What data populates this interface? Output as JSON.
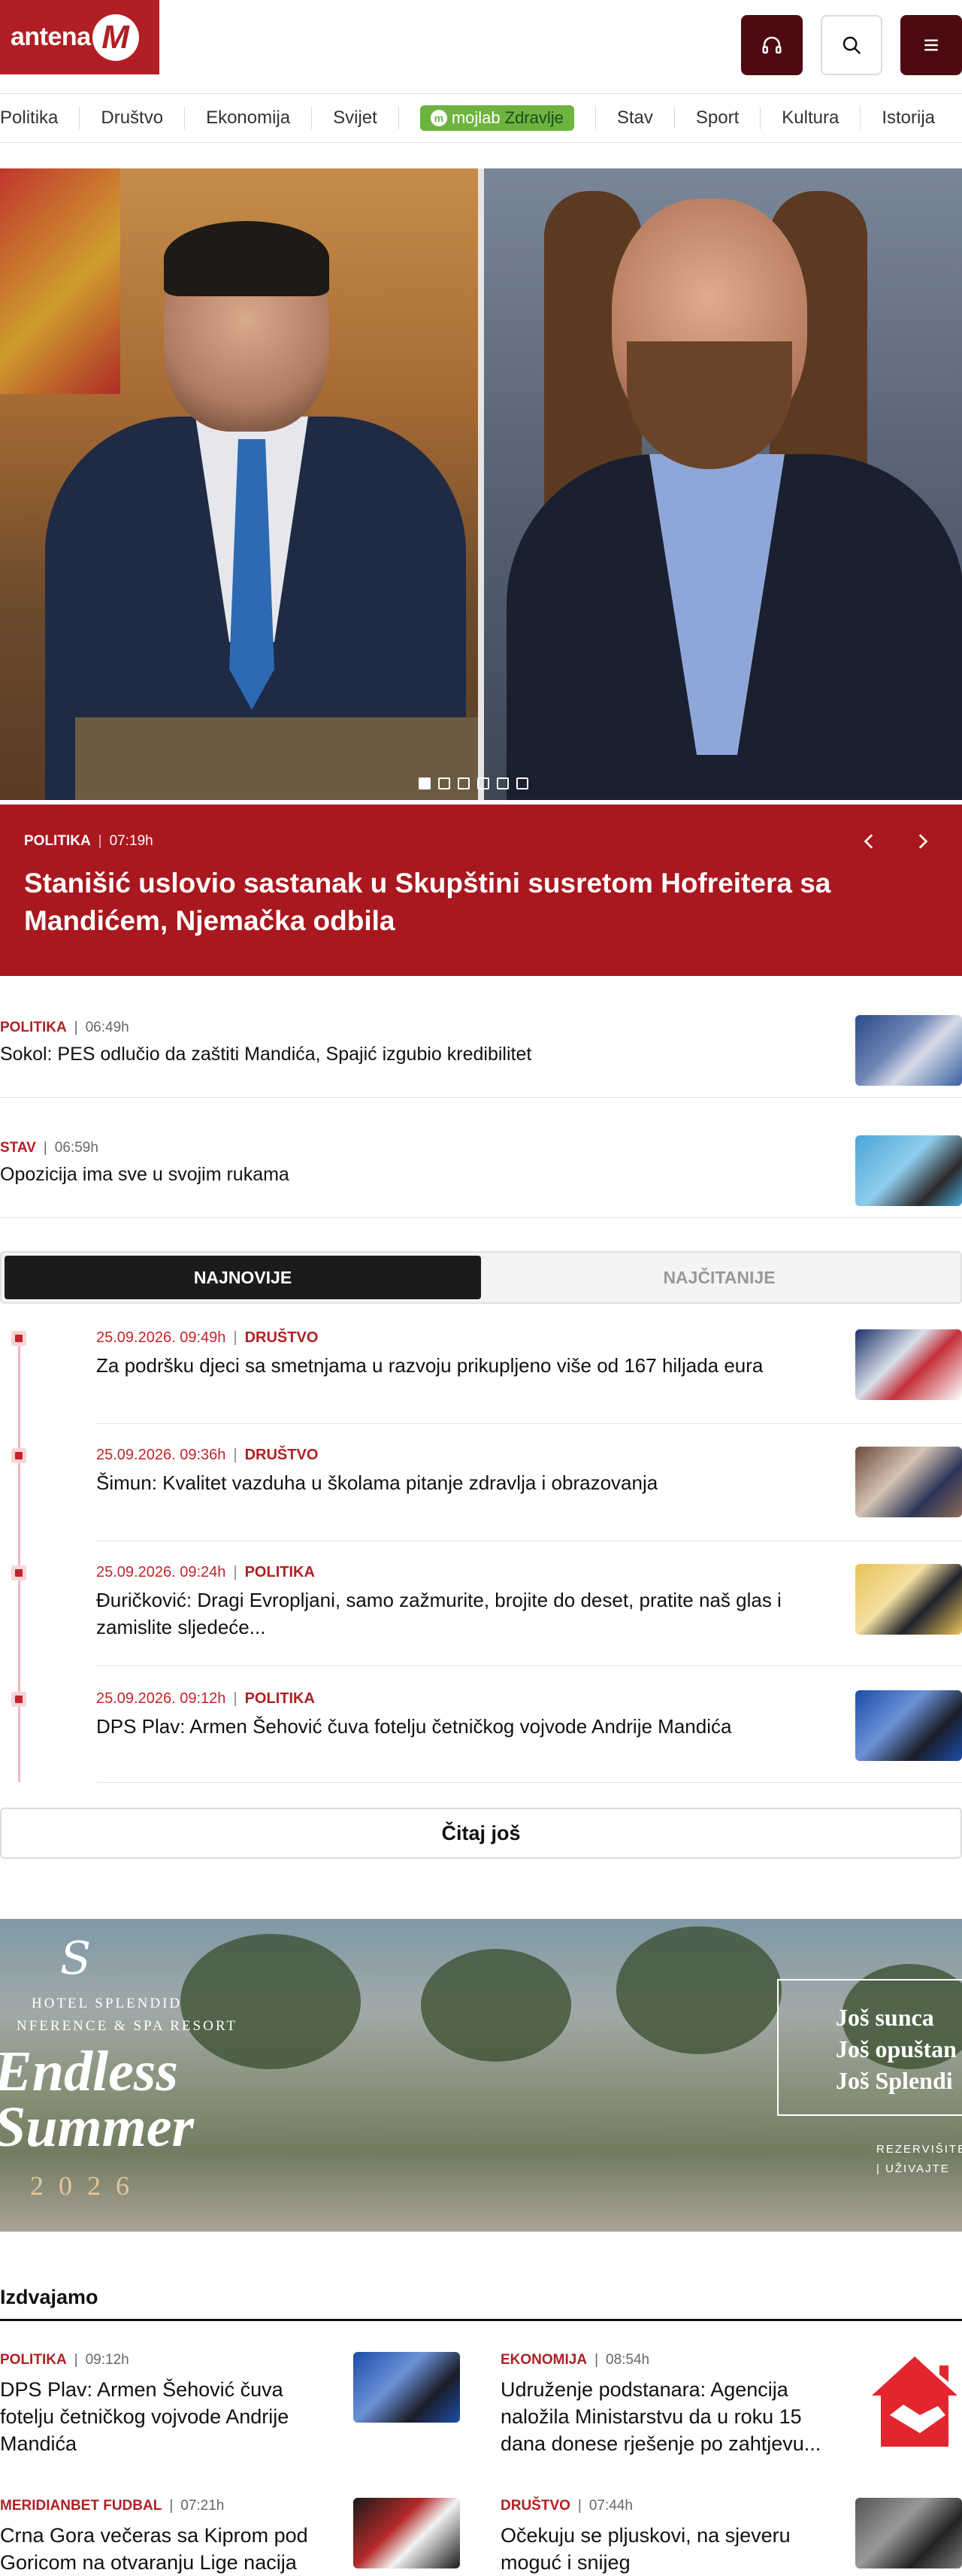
{
  "header": {
    "logo_text": "antena",
    "logo_mark": "M",
    "buttons": [
      "headphones-icon",
      "search-icon",
      "menu-icon"
    ]
  },
  "nav": {
    "items": [
      "Politika",
      "Društvo",
      "Ekonomija",
      "Svijet"
    ],
    "mojlab_label": "mojlab",
    "mojlab_suffix": "Zdravlje",
    "items_after": [
      "Stav",
      "Sport",
      "Kultura",
      "Istorija"
    ]
  },
  "hero": {
    "category": "POLITIKA",
    "time": "07:19h",
    "title": "Stanišić uslovio sastanak u Skupštini susretom Hofreitera sa Mandićem, Njemačka odbila",
    "slide_count": 6,
    "active_slide": 1
  },
  "top_articles": [
    {
      "category": "POLITIKA",
      "time": "06:49h",
      "title": "Sokol: PES odlučio da zaštiti Mandića, Spajić izgubio kredibilitet"
    },
    {
      "category": "STAV",
      "time": "06:59h",
      "title": "Opozicija ima sve u svojim rukama"
    }
  ],
  "tabs": {
    "latest": "NAJNOVIJE",
    "most_read": "NAJČITANIJE"
  },
  "timeline": [
    {
      "date": "25.09.2026. 09:49h",
      "category": "DRUŠTVO",
      "title": "Za podršku djeci sa smetnjama u razvoju prikupljeno više od 167 hiljada eura"
    },
    {
      "date": "25.09.2026. 09:36h",
      "category": "DRUŠTVO",
      "title": "Šimun: Kvalitet vazduha u školama pitanje zdravlja i obrazovanja"
    },
    {
      "date": "25.09.2026. 09:24h",
      "category": "POLITIKA",
      "title": "Đuričković: Dragi Evropljani, samo zažmurite, brojite do deset, pratite naš glas i zamislite sljedeće..."
    },
    {
      "date": "25.09.2026. 09:12h",
      "category": "POLITIKA",
      "title": "DPS Plav: Armen Šehović čuva fotelju četničkog vojvode Andrije Mandića"
    }
  ],
  "more_button": "Čitaj još",
  "ad": {
    "logo": "S",
    "subtitle_1": "HOTEL SPLENDID",
    "subtitle_2": "NFERENCE & SPA RESORT",
    "headline_1": "Endless",
    "headline_2": "Summer",
    "year": "2026",
    "box_lines": [
      "Još sunca",
      "Još opuštan",
      "Još Splendi"
    ],
    "cta_1": "REZERVIŠITE",
    "cta_2": "| UŽIVAJTE"
  },
  "featured": {
    "section_title": "Izdvajamo",
    "items": [
      {
        "category": "POLITIKA",
        "time": "09:12h",
        "title": "DPS Plav: Armen Šehović čuva fotelju četničkog vojvode Andrije Mandića"
      },
      {
        "category": "EKONOMIJA",
        "time": "08:54h",
        "title": "Udruženje podstanara: Agencija naložila Ministarstvu da u roku 15 dana donese rješenje po zahtjevu..."
      },
      {
        "category": "MERIDIANBET FUDBAL",
        "time": "07:21h",
        "title": "Crna Gora večeras sa Kiprom pod Goricom na otvaranju Lige nacija"
      },
      {
        "category": "DRUŠTVO",
        "time": "07:44h",
        "title": "Očekuju se pljuskovi, na sjeveru moguć i snijeg"
      }
    ]
  },
  "colors": {
    "brand_red": "#b11f24",
    "dark_red": "#4d0a10",
    "hero_caption": "#a9171f",
    "mojlab_green": "#6db33f"
  }
}
